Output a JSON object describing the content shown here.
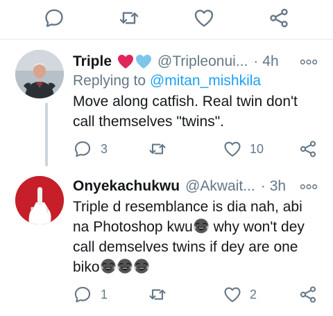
{
  "tweets": [
    {
      "name": "Triple",
      "handle": "@Tripleonui...",
      "time": "4h",
      "reply_prefix": "Replying to ",
      "reply_to": "@mitan_mishkila",
      "text": "Move along catfish. Real twin don't call themselves \"twins\".",
      "counts": {
        "replies": "3",
        "likes": "10"
      }
    },
    {
      "name": "Onyekachukwu",
      "handle": "@Akwait...",
      "time": "3h",
      "text_part1": "Triple d resemblance is dia nah, abi na Photoshop kwu",
      "text_part2": " why won't dey call demselves twins if dey are one biko",
      "counts": {
        "replies": "1",
        "likes": "2"
      }
    }
  ],
  "separator": "·",
  "icons": {
    "reply": "reply-bubble-icon",
    "retweet": "retweet-icon",
    "like": "heart-outline-icon",
    "share": "share-icon",
    "more": "more-dots-icon",
    "emoji": "face-with-tears-of-joy-emoji"
  },
  "colors": {
    "text": "#14171a",
    "secondary": "#657786",
    "link": "#1da1f2",
    "red_heart": "#e0245e",
    "blue_heart": "#7cc7e8"
  }
}
